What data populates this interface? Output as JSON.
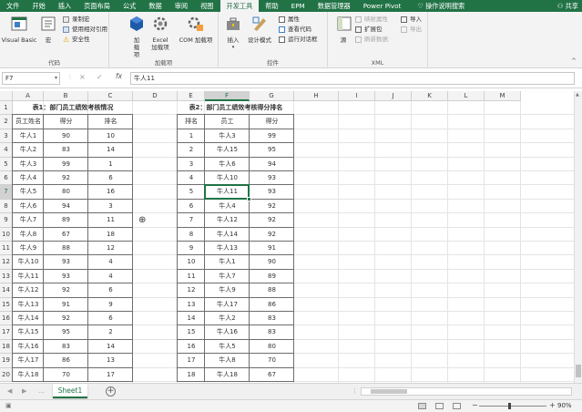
{
  "menu": {
    "tabs": [
      "文件",
      "开始",
      "插入",
      "页面布局",
      "公式",
      "数据",
      "审阅",
      "视图",
      "开发工具",
      "帮助",
      "EPM",
      "数据管理器",
      "Power Pivot"
    ],
    "active_tab": "开发工具",
    "help_search": "操作说明搜索",
    "share": "共享"
  },
  "ribbon": {
    "code": {
      "label": "代码",
      "visual_basic": "Visual Basic",
      "macros": "宏",
      "record_macro": "录制宏",
      "relative_ref": "使用相对引用",
      "macro_security": "安全性"
    },
    "addins": {
      "label": "加载项",
      "addins": "加载项",
      "excel_addins": "Excel 加载项",
      "com_addins": "COM 加载项"
    },
    "controls": {
      "label": "控件",
      "insert": "插入",
      "design_mode": "设计模式",
      "properties": "属性",
      "view_code": "查看代码",
      "run_dialog": "运行对话框"
    },
    "xml": {
      "label": "XML",
      "source": "源",
      "map_properties": "映射属性",
      "expansion_packs": "扩展包",
      "refresh_data": "刷新数据",
      "import": "导入",
      "export": "导出"
    }
  },
  "formula_bar": {
    "name_box": "F7",
    "cancel": "×",
    "enter": "✓",
    "fx": "fx",
    "content": "牛人11"
  },
  "columns": [
    "A",
    "B",
    "C",
    "D",
    "E",
    "F",
    "G",
    "H",
    "I",
    "J",
    "K",
    "L",
    "M"
  ],
  "rows": [
    "1",
    "2",
    "3",
    "4",
    "5",
    "6",
    "7",
    "8",
    "9",
    "10",
    "11",
    "12",
    "13",
    "14",
    "15",
    "16",
    "17",
    "18",
    "19",
    "20"
  ],
  "selected_cell": "F7",
  "table1": {
    "title": "表1：部门员工绩效考核情况",
    "headers": [
      "员工姓名",
      "得分",
      "排名"
    ],
    "rows": [
      [
        "牛人1",
        "90",
        "10"
      ],
      [
        "牛人2",
        "83",
        "14"
      ],
      [
        "牛人3",
        "99",
        "1"
      ],
      [
        "牛人4",
        "92",
        "6"
      ],
      [
        "牛人5",
        "80",
        "16"
      ],
      [
        "牛人6",
        "94",
        "3"
      ],
      [
        "牛人7",
        "89",
        "11"
      ],
      [
        "牛人8",
        "67",
        "18"
      ],
      [
        "牛人9",
        "88",
        "12"
      ],
      [
        "牛人10",
        "93",
        "4"
      ],
      [
        "牛人11",
        "93",
        "4"
      ],
      [
        "牛人12",
        "92",
        "6"
      ],
      [
        "牛人13",
        "91",
        "9"
      ],
      [
        "牛人14",
        "92",
        "6"
      ],
      [
        "牛人15",
        "95",
        "2"
      ],
      [
        "牛人16",
        "83",
        "14"
      ],
      [
        "牛人17",
        "86",
        "13"
      ],
      [
        "牛人18",
        "70",
        "17"
      ]
    ]
  },
  "table2": {
    "title": "表2：部门员工绩效考核得分排名",
    "headers": [
      "排名",
      "员工",
      "得分"
    ],
    "rows": [
      [
        "1",
        "牛人3",
        "99"
      ],
      [
        "2",
        "牛人15",
        "95"
      ],
      [
        "3",
        "牛人6",
        "94"
      ],
      [
        "4",
        "牛人10",
        "93"
      ],
      [
        "5",
        "牛人11",
        "93"
      ],
      [
        "6",
        "牛人4",
        "92"
      ],
      [
        "7",
        "牛人12",
        "92"
      ],
      [
        "8",
        "牛人14",
        "92"
      ],
      [
        "9",
        "牛人13",
        "91"
      ],
      [
        "10",
        "牛人1",
        "90"
      ],
      [
        "11",
        "牛人7",
        "89"
      ],
      [
        "12",
        "牛人9",
        "88"
      ],
      [
        "13",
        "牛人17",
        "86"
      ],
      [
        "14",
        "牛人2",
        "83"
      ],
      [
        "15",
        "牛人16",
        "83"
      ],
      [
        "16",
        "牛人5",
        "80"
      ],
      [
        "17",
        "牛人8",
        "70"
      ],
      [
        "18",
        "牛人18",
        "67"
      ]
    ]
  },
  "sheets": [
    "Sheet1"
  ],
  "active_sheet": "Sheet1",
  "status": {
    "zoom": "90%",
    "zoom_level": 0.9
  },
  "colors": {
    "accent": "#217346",
    "ribbon_bg": "#f3f3f3",
    "header_bg": "#f3f3f3",
    "gridline": "#e4e4e4"
  }
}
